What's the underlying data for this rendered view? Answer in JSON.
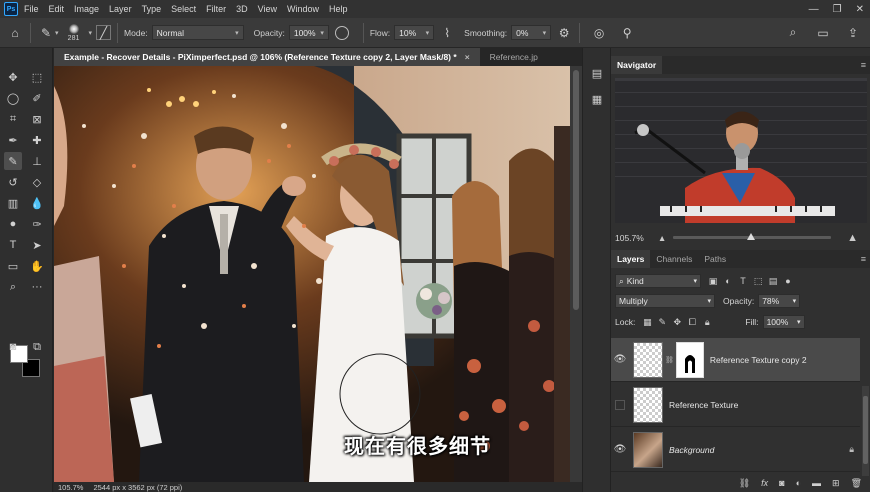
{
  "app": {
    "logo_text": "Ps"
  },
  "menu": [
    "File",
    "Edit",
    "Image",
    "Layer",
    "Type",
    "Select",
    "Filter",
    "3D",
    "View",
    "Window",
    "Help"
  ],
  "window_controls": [
    "—",
    "❐",
    "✕"
  ],
  "options": {
    "brush_size": "281",
    "mode_label": "Mode:",
    "mode_value": "Normal",
    "opacity_label": "Opacity:",
    "opacity_value": "100%",
    "flow_label": "Flow:",
    "flow_value": "10%",
    "smoothing_label": "Smoothing:",
    "smoothing_value": "0%"
  },
  "tabs": [
    {
      "label": "Example - Recover Details - PiXimperfect.psd @ 106% (Reference Texture copy 2, Layer Mask/8) *",
      "close": "×"
    },
    {
      "label": "Reference.jp"
    }
  ],
  "canvas": {
    "subtitle": "现在有很多细节"
  },
  "status": {
    "zoom": "105.7%",
    "dimensions": "2544 px x 3562 px (72 ppi)"
  },
  "navigator": {
    "title": "Navigator",
    "zoom": "105.7%"
  },
  "layers_panel": {
    "tabs": [
      "Layers",
      "Channels",
      "Paths"
    ],
    "kind_label": "Kind",
    "blend_mode": "Multiply",
    "opacity_label": "Opacity:",
    "opacity_value": "78%",
    "lock_label": "Lock:",
    "fill_label": "Fill:",
    "fill_value": "100%",
    "layers": [
      {
        "name": "Reference Texture copy 2",
        "visible": true,
        "selected": true
      },
      {
        "name": "Reference Texture",
        "visible": false,
        "selected": false
      },
      {
        "name": "Background",
        "visible": true,
        "selected": false
      }
    ]
  },
  "colors": {
    "accent": "#31a8ff",
    "panel": "#303030",
    "selected_layer": "#4a4a4a"
  }
}
